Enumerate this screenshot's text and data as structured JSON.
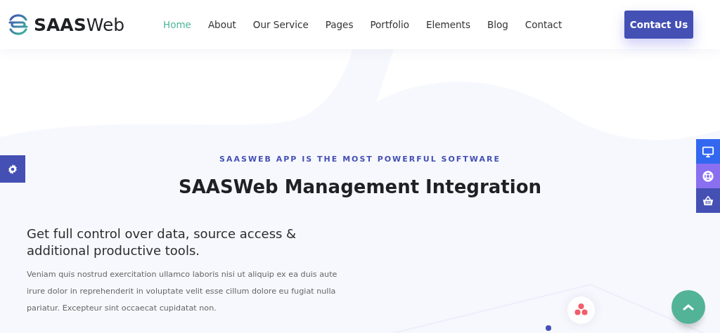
{
  "header": {
    "logo": {
      "bold": "SAAS",
      "light": "Web"
    },
    "nav": [
      {
        "label": "Home",
        "selected": true
      },
      {
        "label": "About",
        "selected": false
      },
      {
        "label": "Our Service",
        "selected": false
      },
      {
        "label": "Pages",
        "selected": false
      },
      {
        "label": "Portfolio",
        "selected": false
      },
      {
        "label": "Elements",
        "selected": false
      },
      {
        "label": "Blog",
        "selected": false
      },
      {
        "label": "Contact",
        "selected": false
      }
    ],
    "cta": "Contact Us"
  },
  "hero": {
    "eyebrow": "SAASWEB APP IS THE MOST POWERFUL SOFTWARE",
    "title": "SAASWeb Management Integration",
    "lead": "Get full control over data, source access & additional productive tools.",
    "body": "Veniam quis nostrud exercitation ullamco laboris nisi ut aliquip ex ea duis aute irure dolor in reprehenderit in voluptate velit esse cillum dolore eu fugiat nulla pariatur. Excepteur sint occaecat cupidatat non."
  },
  "side_tabs": [
    {
      "kind": "monitor",
      "color": "#3367f0"
    },
    {
      "kind": "lifebuoy",
      "color": "#8a6ff0"
    },
    {
      "kind": "basket",
      "color": "#4450b4"
    }
  ]
}
